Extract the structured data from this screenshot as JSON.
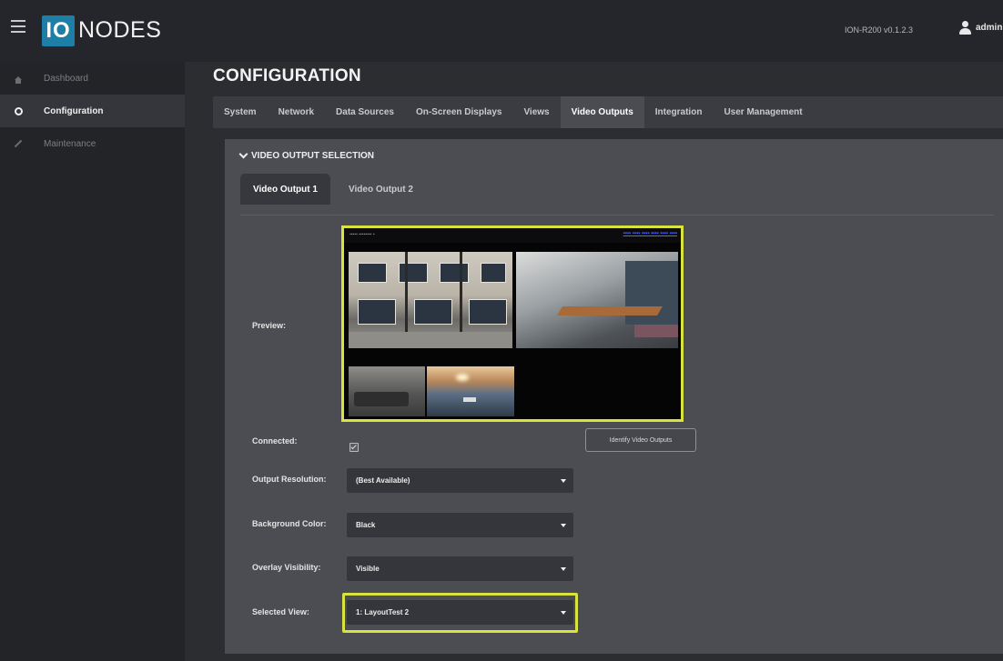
{
  "header": {
    "logo_box_text": "IO",
    "logo_text": "NODES",
    "version": "ION-R200  v0.1.2.3",
    "user": "admin"
  },
  "sidebar": {
    "items": [
      {
        "label": "Dashboard",
        "icon": "home-icon",
        "active": false
      },
      {
        "label": "Configuration",
        "icon": "gear-icon",
        "active": true
      },
      {
        "label": "Maintenance",
        "icon": "wrench-icon",
        "active": false
      }
    ]
  },
  "page": {
    "title": "CONFIGURATION",
    "tabs": [
      "System",
      "Network",
      "Data Sources",
      "On-Screen Displays",
      "Views",
      "Video Outputs",
      "Integration",
      "User Management"
    ],
    "active_tab": "Video Outputs"
  },
  "section": {
    "header": "VIDEO OUTPUT SELECTION",
    "output_tabs": [
      "Video Output 1",
      "Video Output 2"
    ],
    "active_output": "Video Output 1"
  },
  "form": {
    "preview_label": "Preview:",
    "connected_label": "Connected:",
    "connected_checked": true,
    "identify_button": "Identify Video Outputs",
    "output_resolution_label": "Output Resolution:",
    "output_resolution_value": "(Best Available)",
    "background_color_label": "Background Color:",
    "background_color_value": "Black",
    "overlay_visibility_label": "Overlay Visibility:",
    "overlay_visibility_value": "Visible",
    "selected_view_label": "Selected View:",
    "selected_view_value": "1: LayoutTest 2"
  },
  "colors": {
    "highlight": "#d8e43b",
    "logo_accent": "#1e7fa6"
  }
}
